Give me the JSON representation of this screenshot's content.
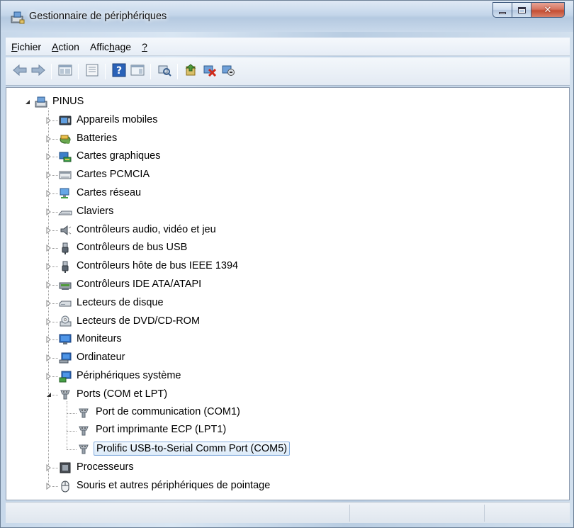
{
  "window": {
    "title": "Gestionnaire de périphériques",
    "accent_color": "#84acdd",
    "close_color": "#c44d33"
  },
  "menu": [
    {
      "label": "Fichier",
      "underline_index": 0
    },
    {
      "label": "Action",
      "underline_index": 0
    },
    {
      "label": "Affichage",
      "underline_index": 5
    },
    {
      "label": "?",
      "underline_index": 0
    }
  ],
  "toolbar": {
    "buttons": [
      {
        "icon": "back-arrow-icon"
      },
      {
        "icon": "forward-arrow-icon"
      },
      {
        "icon": "show-hide-console-tree-icon"
      },
      {
        "icon": "properties-icon"
      },
      {
        "icon": "help-icon"
      },
      {
        "icon": "action-pane-icon"
      },
      {
        "icon": "scan-hardware-icon"
      },
      {
        "icon": "update-driver-icon"
      },
      {
        "icon": "uninstall-icon"
      },
      {
        "icon": "disable-device-icon"
      }
    ]
  },
  "tree": {
    "root": {
      "label": "PINUS",
      "icon": "computer-icon",
      "expanded": true
    },
    "categories": [
      {
        "label": "Appareils mobiles",
        "icon": "mobile-device-icon",
        "expanded": false
      },
      {
        "label": "Batteries",
        "icon": "battery-icon",
        "expanded": false
      },
      {
        "label": "Cartes graphiques",
        "icon": "display-adapter-icon",
        "expanded": false
      },
      {
        "label": "Cartes PCMCIA",
        "icon": "pcmcia-icon",
        "expanded": false
      },
      {
        "label": "Cartes réseau",
        "icon": "network-adapter-icon",
        "expanded": false
      },
      {
        "label": "Claviers",
        "icon": "keyboard-icon",
        "expanded": false
      },
      {
        "label": "Contrôleurs audio, vidéo et jeu",
        "icon": "speaker-icon",
        "expanded": false
      },
      {
        "label": "Contrôleurs de bus USB",
        "icon": "usb-plug-icon",
        "expanded": false
      },
      {
        "label": "Contrôleurs hôte de bus IEEE 1394",
        "icon": "usb-plug-icon",
        "expanded": false
      },
      {
        "label": "Contrôleurs IDE ATA/ATAPI",
        "icon": "ide-controller-icon",
        "expanded": false
      },
      {
        "label": "Lecteurs de disque",
        "icon": "disk-drive-icon",
        "expanded": false
      },
      {
        "label": "Lecteurs de DVD/CD-ROM",
        "icon": "dvd-drive-icon",
        "expanded": false
      },
      {
        "label": "Moniteurs",
        "icon": "monitor-icon",
        "expanded": false
      },
      {
        "label": "Ordinateur",
        "icon": "computer-monitor-icon",
        "expanded": false
      },
      {
        "label": "Périphériques système",
        "icon": "system-device-icon",
        "expanded": false
      },
      {
        "label": "Ports (COM et LPT)",
        "icon": "port-icon",
        "expanded": true,
        "children": [
          {
            "label": "Port de communication (COM1)",
            "icon": "port-icon",
            "selected": false
          },
          {
            "label": "Port imprimante ECP (LPT1)",
            "icon": "port-icon",
            "selected": false
          },
          {
            "label": "Prolific USB-to-Serial Comm Port (COM5)",
            "icon": "port-icon",
            "selected": true
          }
        ]
      },
      {
        "label": "Processeurs",
        "icon": "processor-icon",
        "expanded": false
      },
      {
        "label": "Souris et autres périphériques de pointage",
        "icon": "mouse-icon",
        "expanded": false
      }
    ]
  }
}
